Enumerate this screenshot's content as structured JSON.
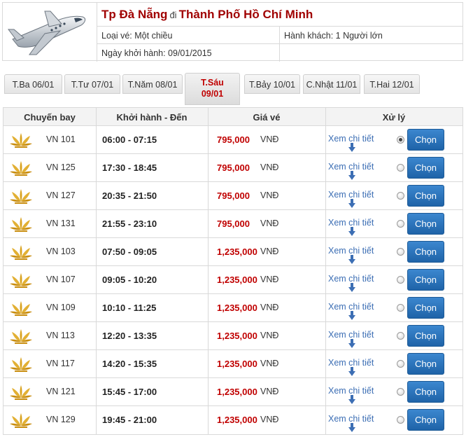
{
  "route": {
    "from": "Tp Đà Nẵng",
    "connector": "đi",
    "to": "Thành Phố Hồ Chí Minh"
  },
  "ticket_type": "Loại vé: Một chiều",
  "passengers": "Hành khách: 1 Người lớn",
  "departure_date": "Ngày khởi hành: 09/01/2015",
  "tabs": [
    {
      "label": "T.Ba 06/01"
    },
    {
      "label": "T.Tư 07/01"
    },
    {
      "label": "T.Năm 08/01"
    },
    {
      "label_line1": "T.Sáu",
      "label_line2": "09/01",
      "active": true
    },
    {
      "label": "T.Bảy 10/01"
    },
    {
      "label": "C.Nhật 11/01"
    },
    {
      "label": "T.Hai 12/01"
    }
  ],
  "columns": {
    "flight": "Chuyến bay",
    "time": "Khởi hành - Đến",
    "price": "Giá vé",
    "action": "Xử lý"
  },
  "detail_label": "Xem chi tiết",
  "choose_label": "Chọn",
  "currency": "VNĐ",
  "colors": {
    "price": "#c00000",
    "route": "#a00000",
    "button": "#2a72bb",
    "link": "#3c6eb4"
  },
  "flights": [
    {
      "code": "VN 101",
      "time": "06:00 - 07:15",
      "price": "795,000",
      "selected": true
    },
    {
      "code": "VN 125",
      "time": "17:30 - 18:45",
      "price": "795,000"
    },
    {
      "code": "VN 127",
      "time": "20:35 - 21:50",
      "price": "795,000"
    },
    {
      "code": "VN 131",
      "time": "21:55 - 23:10",
      "price": "795,000"
    },
    {
      "code": "VN 103",
      "time": "07:50 - 09:05",
      "price": "1,235,000"
    },
    {
      "code": "VN 107",
      "time": "09:05 - 10:20",
      "price": "1,235,000"
    },
    {
      "code": "VN 109",
      "time": "10:10 - 11:25",
      "price": "1,235,000"
    },
    {
      "code": "VN 113",
      "time": "12:20 - 13:35",
      "price": "1,235,000"
    },
    {
      "code": "VN 117",
      "time": "14:20 - 15:35",
      "price": "1,235,000"
    },
    {
      "code": "VN 121",
      "time": "15:45 - 17:00",
      "price": "1,235,000"
    },
    {
      "code": "VN 129",
      "time": "19:45 - 21:00",
      "price": "1,235,000"
    }
  ]
}
